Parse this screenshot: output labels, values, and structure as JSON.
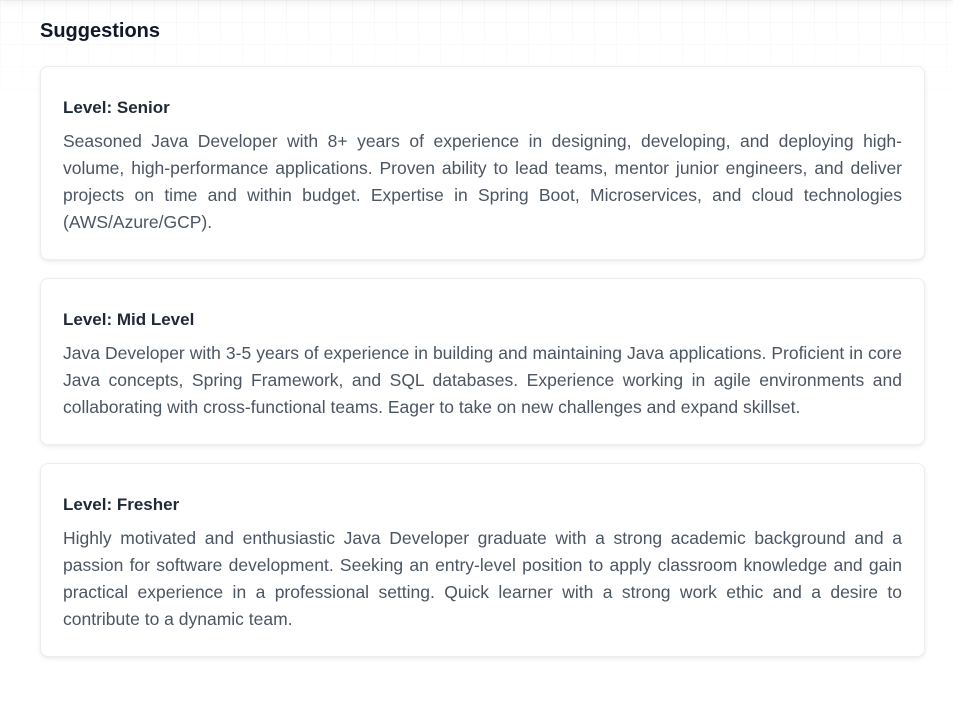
{
  "header": {
    "title": "Suggestions"
  },
  "suggestions": [
    {
      "level": "Level: Senior",
      "text": "Seasoned Java Developer with 8+ years of experience in designing, developing, and deploying high-volume, high-performance applications. Proven ability to lead teams, mentor junior engineers, and deliver projects on time and within budget. Expertise in Spring Boot, Microservices, and cloud technologies (AWS/Azure/GCP)."
    },
    {
      "level": "Level: Mid Level",
      "text": "Java Developer with 3-5 years of experience in building and maintaining Java applications. Proficient in core Java concepts, Spring Framework, and SQL databases. Experience working in agile environments and collaborating with cross-functional teams. Eager to take on new challenges and expand skillset."
    },
    {
      "level": "Level: Fresher",
      "text": "Highly motivated and enthusiastic Java Developer graduate with a strong academic background and a passion for software development. Seeking an entry-level position to apply classroom knowledge and gain practical experience in a professional setting. Quick learner with a strong work ethic and a desire to contribute to a dynamic team."
    }
  ]
}
